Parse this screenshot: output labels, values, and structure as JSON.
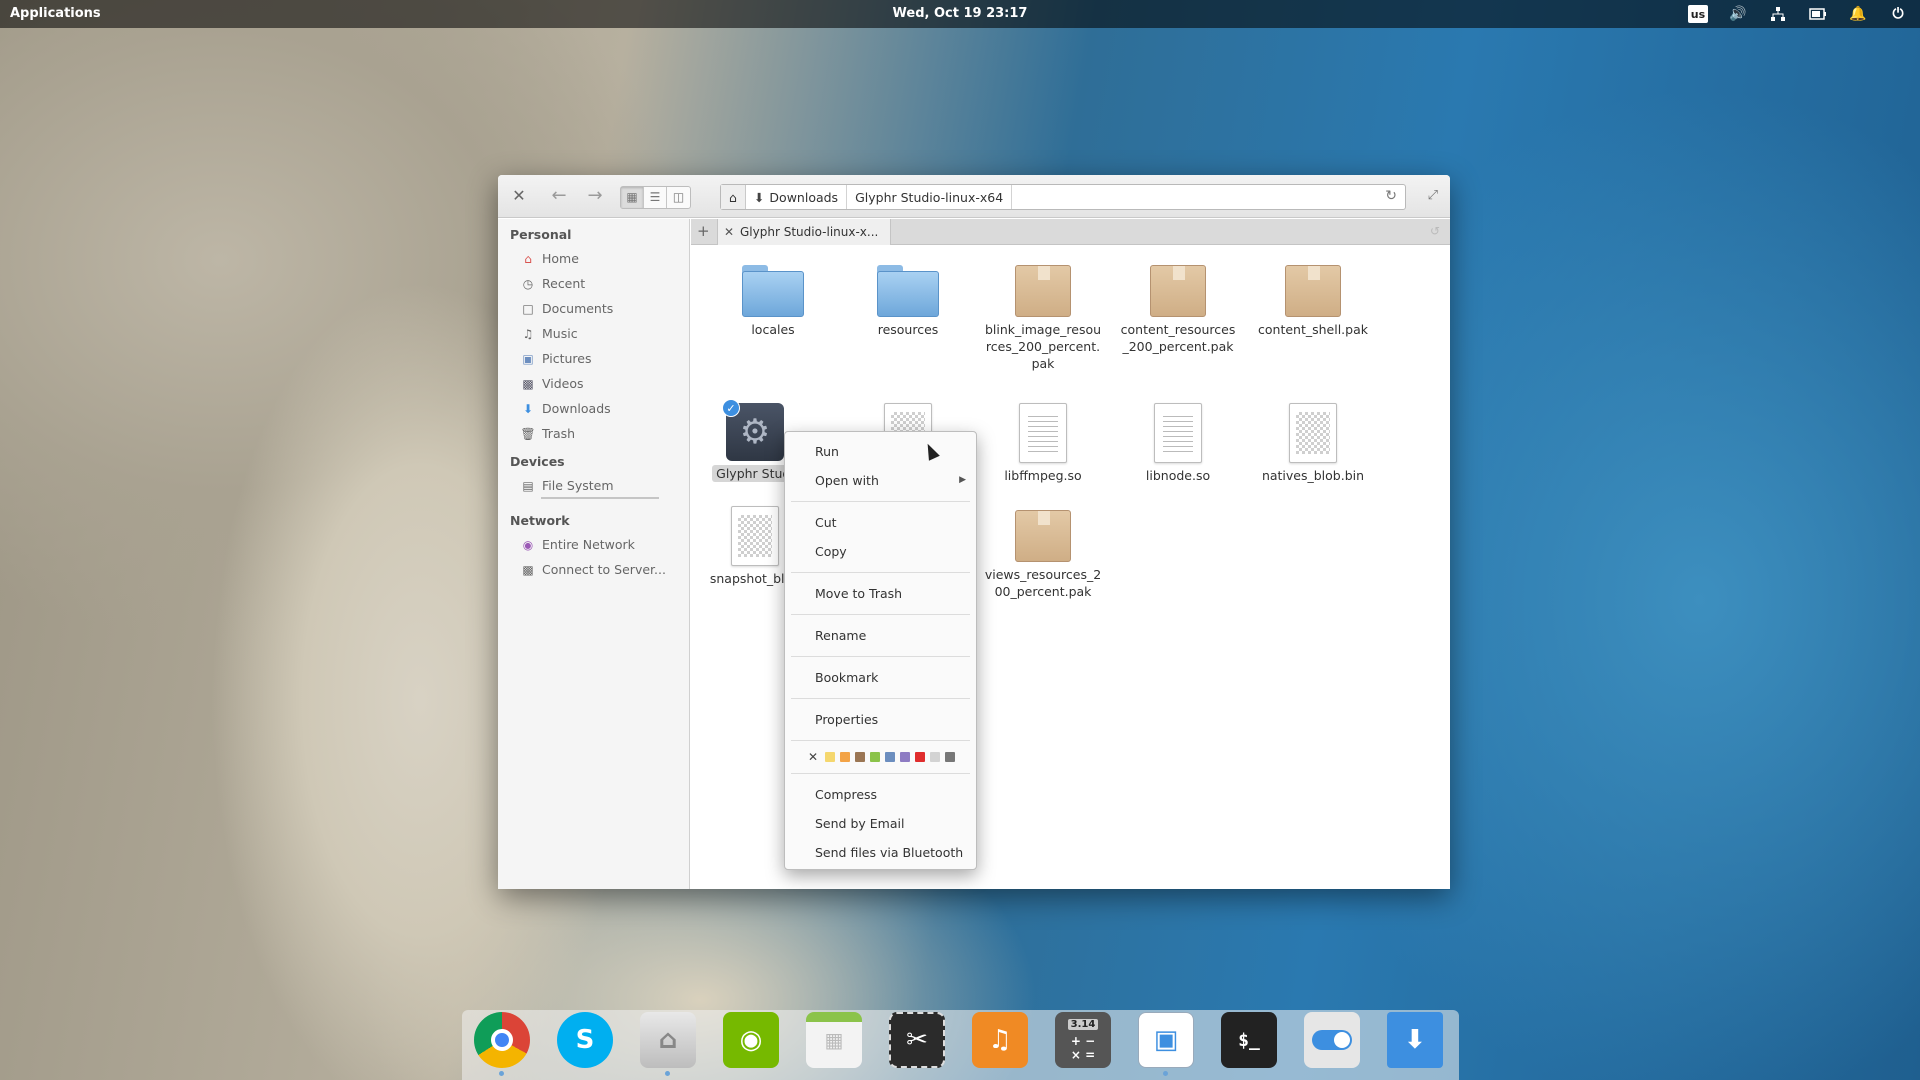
{
  "panel": {
    "applications_label": "Applications",
    "clock": "Wed, Oct 19   23:17",
    "keyboard_layout": "us",
    "indicators": [
      "sound-icon",
      "network-icon",
      "battery-icon",
      "notifications-icon",
      "power-icon"
    ]
  },
  "toolbar": {
    "path": {
      "home_icon": "home-icon",
      "segments": [
        "Downloads",
        "Glyphr Studio-linux-x64"
      ]
    }
  },
  "sidebar": {
    "personal_header": "Personal",
    "personal_items": [
      "Home",
      "Recent",
      "Documents",
      "Music",
      "Pictures",
      "Videos",
      "Downloads",
      "Trash"
    ],
    "devices_header": "Devices",
    "devices_items": [
      "File System"
    ],
    "network_header": "Network",
    "network_items": [
      "Entire Network",
      "Connect to Server..."
    ]
  },
  "tabs": {
    "active_tab_label": "Glyphr Studio-linux-x..."
  },
  "files": [
    {
      "name": "locales",
      "kind": "folder"
    },
    {
      "name": "resources",
      "kind": "folder"
    },
    {
      "name": "blink_image_resources_200_percent.pak",
      "kind": "package"
    },
    {
      "name": "content_resources_200_percent.pak",
      "kind": "package"
    },
    {
      "name": "content_shell.pak",
      "kind": "package"
    },
    {
      "name": "Glyphr Studi",
      "kind": "executable",
      "selected": true
    },
    {
      "name": "",
      "kind": "binary"
    },
    {
      "name": "libffmpeg.so",
      "kind": "text"
    },
    {
      "name": "libnode.so",
      "kind": "text"
    },
    {
      "name": "natives_blob.bin",
      "kind": "binary"
    },
    {
      "name": "snapshot_blob",
      "kind": "binary"
    },
    {
      "name": "views_resources_200_percent.pak",
      "kind": "package"
    }
  ],
  "context_menu": {
    "items": [
      "Run",
      "Open with",
      "Cut",
      "Copy",
      "Move to Trash",
      "Rename",
      "Bookmark",
      "Properties",
      "Compress",
      "Send by Email",
      "Send files via Bluetooth"
    ],
    "tag_colors": [
      "#f5d76e",
      "#f3a346",
      "#9b7654",
      "#8bc34a",
      "#6c8ebf",
      "#8e7cc3",
      "#e02d2d",
      "#d3d3d3",
      "#777777"
    ]
  },
  "dock": {
    "apps": [
      "chrome",
      "skype",
      "files",
      "nvidia-settings",
      "calendar",
      "screenshot",
      "music",
      "calculator",
      "document-viewer",
      "terminal",
      "settings-switch",
      "downloads"
    ],
    "calculator_display": "3.14"
  }
}
